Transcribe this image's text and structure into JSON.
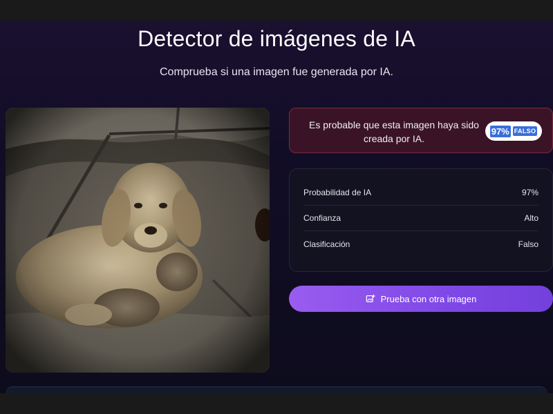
{
  "header": {
    "title": "Detector de imágenes de IA",
    "subtitle": "Comprueba si una imagen fue generada por IA."
  },
  "result": {
    "message": "Es probable que esta imagen haya sido creada por IA.",
    "badge_percent": "97%",
    "badge_label": "FALSO",
    "accent_color": "#7a2a44"
  },
  "details": [
    {
      "label": "Probabilidad de IA",
      "value": "97%"
    },
    {
      "label": "Confianza",
      "value": "Alto"
    },
    {
      "label": "Clasificación",
      "value": "Falso"
    }
  ],
  "actions": {
    "retry_label": "Prueba con otra imagen",
    "retry_icon": "image-plus-icon",
    "button_color": "#8b52ea"
  },
  "image": {
    "subject": "dog-and-kittens-in-rubble"
  }
}
